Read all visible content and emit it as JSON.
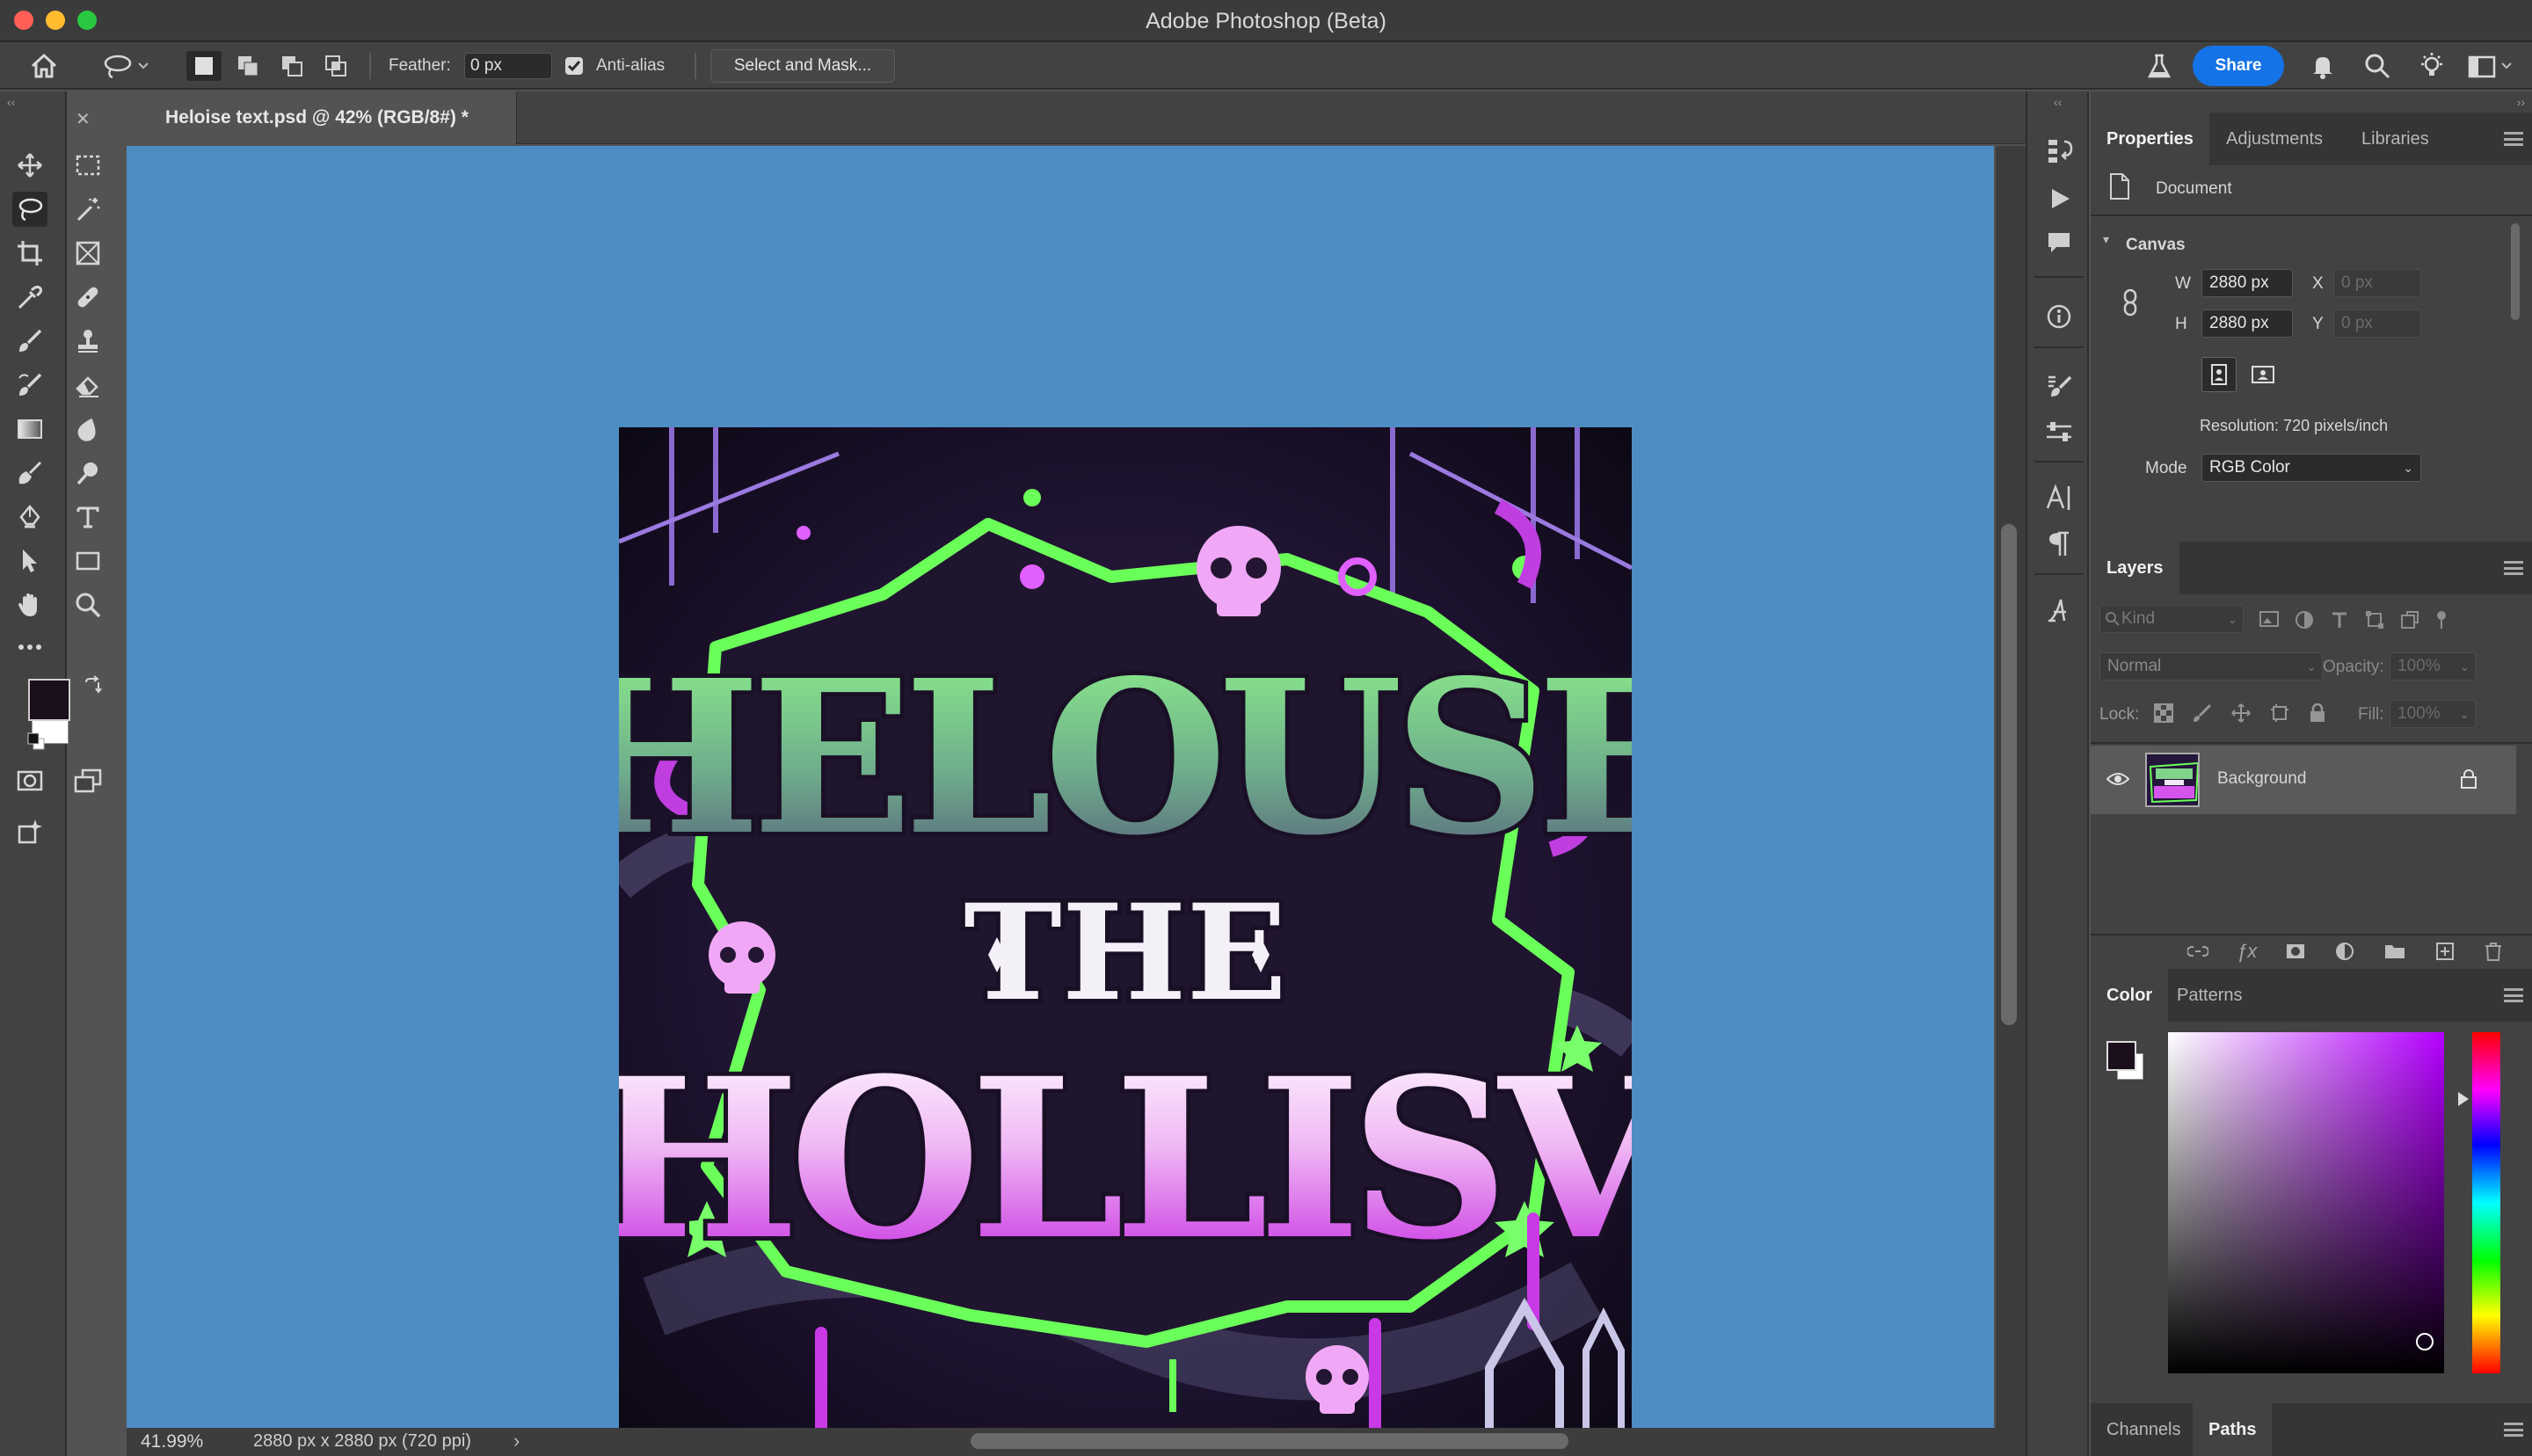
{
  "app": {
    "window_title": "Adobe Photoshop (Beta)"
  },
  "options_bar": {
    "feather_label": "Feather:",
    "feather_value": "0 px",
    "antialias_label": "Anti-alias",
    "select_mask_label": "Select and Mask...",
    "share_label": "Share"
  },
  "document": {
    "tab_title": "Heloise text.psd @ 42% (RGB/8#) *",
    "zoom": "41.99%",
    "info": "2880 px x 2880 px (720 ppi)"
  },
  "artwork": {
    "line1": "HELOUSE",
    "line2": "THE",
    "line3": "HOLLISV"
  },
  "properties": {
    "tabs": [
      "Properties",
      "Adjustments",
      "Libraries"
    ],
    "document_label": "Document",
    "canvas_label": "Canvas",
    "w_label": "W",
    "w_value": "2880 px",
    "h_label": "H",
    "h_value": "2880 px",
    "x_label": "X",
    "x_value": "0 px",
    "y_label": "Y",
    "y_value": "0 px",
    "resolution": "Resolution: 720 pixels/inch",
    "mode_label": "Mode",
    "mode_value": "RGB Color"
  },
  "layers": {
    "tab": "Layers",
    "kind_placeholder": "Kind",
    "blend_mode": "Normal",
    "opacity_label": "Opacity:",
    "opacity_value": "100%",
    "lock_label": "Lock:",
    "fill_label": "Fill:",
    "fill_value": "100%",
    "items": [
      {
        "name": "Background"
      }
    ]
  },
  "color_panel": {
    "tabs": [
      "Color",
      "Patterns"
    ],
    "foreground": "#1a0f1a",
    "background": "#ffffff",
    "hue_color": "#b400ff"
  },
  "bottom_panel": {
    "tabs": [
      "Channels",
      "Paths"
    ]
  },
  "colors": {
    "canvas_bg": "#4d8dc3",
    "accent": "#1473e6"
  }
}
